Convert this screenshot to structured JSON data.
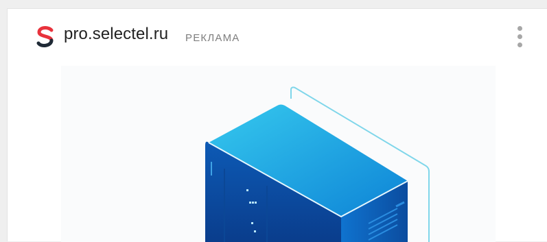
{
  "ad": {
    "domain": "pro.selectel.ru",
    "label": "РЕКЛАМА"
  },
  "icons": {
    "brand_logo": "selectel-s-logo-icon",
    "menu": "more-vertical-icon"
  },
  "colors": {
    "logo_red": "#e8323c",
    "logo_dark": "#1f2a36",
    "server_light": "#23c0e8",
    "server_dark": "#0a4ba0",
    "outline_cyan": "#7fd6ea"
  }
}
